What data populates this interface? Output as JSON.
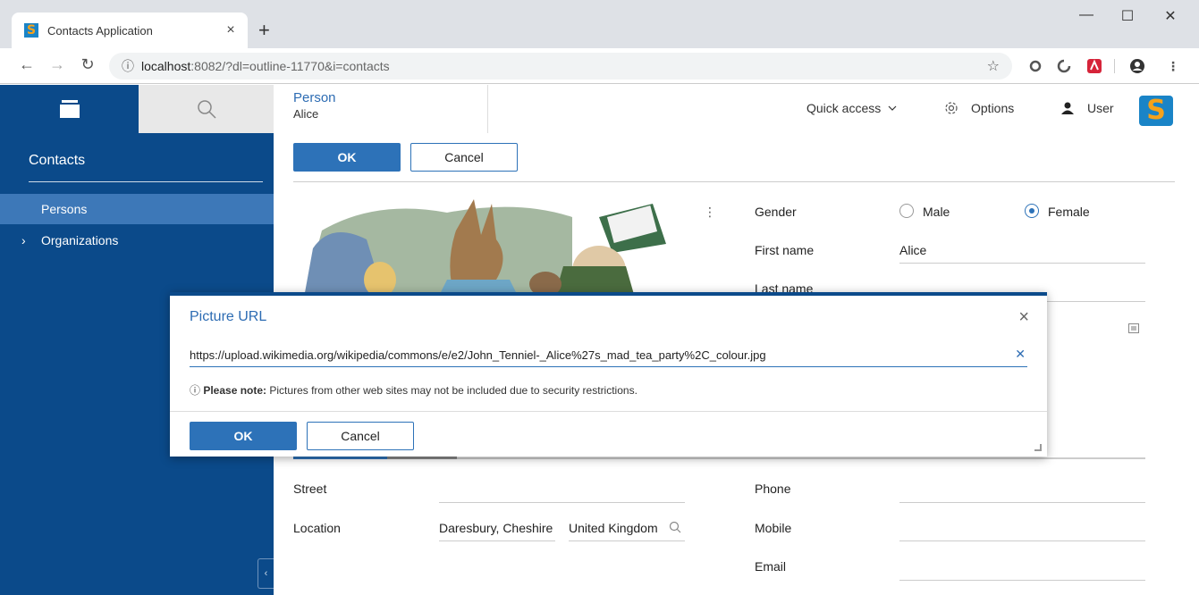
{
  "browser": {
    "tab_title": "Contacts Application",
    "tab_close": "×",
    "new_tab": "+",
    "win_min": "—",
    "win_max": "☐",
    "win_close": "✕",
    "url_host": "localhost",
    "url_rest": ":8082/?dl=outline-11770&i=contacts"
  },
  "sidebar": {
    "title": "Contacts",
    "items": [
      {
        "label": "Persons",
        "active": true
      },
      {
        "label": "Organizations",
        "active": false
      }
    ]
  },
  "header": {
    "tab_title": "Person",
    "tab_subtitle": "Alice",
    "quick_access": "Quick access",
    "options": "Options",
    "user": "User"
  },
  "form": {
    "ok_label": "OK",
    "cancel_label": "Cancel",
    "gender_label": "Gender",
    "gender_options": [
      "Male",
      "Female"
    ],
    "gender_selected": "Female",
    "first_name_label": "First name",
    "first_name_value": "Alice",
    "last_name_label": "Last name",
    "street_label": "Street",
    "location_label": "Location",
    "location_city": "Daresbury, Cheshire",
    "location_country": "United Kingdom",
    "phone_label": "Phone",
    "mobile_label": "Mobile",
    "email_label": "Email"
  },
  "dialog": {
    "title": "Picture URL",
    "url_value": "https://upload.wikimedia.org/wikipedia/commons/e/e2/John_Tenniel-_Alice%27s_mad_tea_party%2C_colour.jpg",
    "note_bold": "Please note:",
    "note_text": "Pictures from other web sites may not be included due to security restrictions.",
    "ok_label": "OK",
    "cancel_label": "Cancel"
  },
  "colors": {
    "sidebar": "#0b4a8a",
    "accent": "#2d72b8",
    "active_item": "#3d78b8"
  }
}
